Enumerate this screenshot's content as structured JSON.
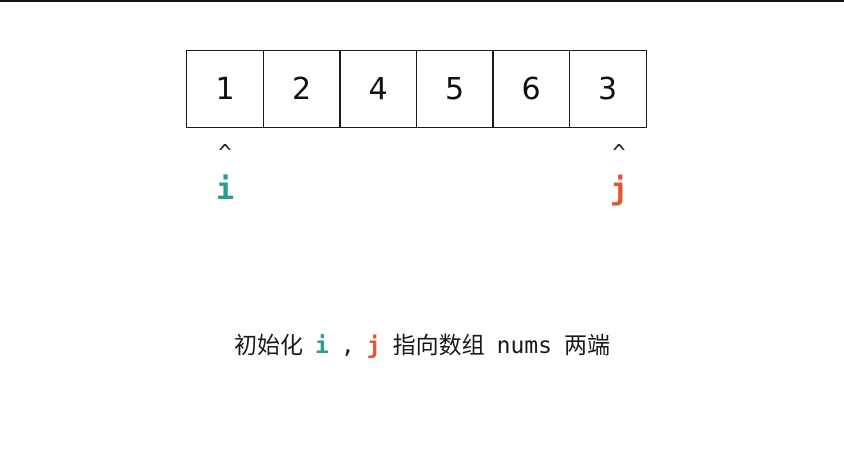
{
  "array": {
    "values": [
      "1",
      "2",
      "4",
      "5",
      "6",
      "3"
    ]
  },
  "pointers": {
    "caret": "^",
    "i": {
      "label": "i",
      "color": "#2a9d8f"
    },
    "j": {
      "label": "j",
      "color": "#e4572e"
    }
  },
  "caption": {
    "prefix": "初始化",
    "i_label": "i",
    "comma": ",",
    "j_label": "j",
    "middle": "指向数组",
    "code": "nums",
    "suffix": "两端"
  }
}
